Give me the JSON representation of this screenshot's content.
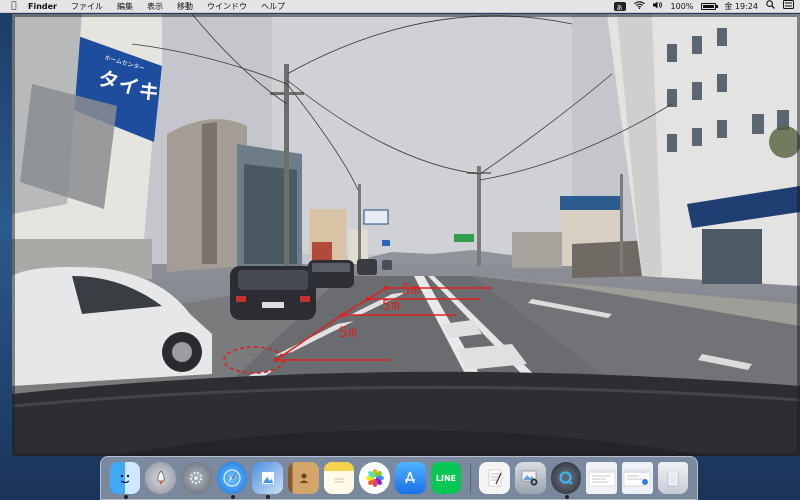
{
  "menubar": {
    "app_name": "Finder",
    "menus": [
      "ファイル",
      "編集",
      "表示",
      "移動",
      "ウインドウ",
      "ヘルプ"
    ],
    "input_source": "あ",
    "battery_percent": "100%",
    "battery_level": 1.0,
    "clock": "金 19:24"
  },
  "photo": {
    "sign_text": "タイキ",
    "sign_small": "ホームセンター",
    "annotations": [
      "5m",
      "5m",
      "5m"
    ],
    "annotation_color": "#e02020"
  },
  "dock": {
    "apps": [
      "Finder",
      "Launchpad",
      "System Preferences",
      "Safari",
      "Preview",
      "Contacts",
      "Notes",
      "Photos",
      "App Store",
      "LINE"
    ],
    "line_label": "LINE",
    "others": [
      "TextEdit",
      "Image Capture",
      "QuickTime Player",
      "Window 1",
      "Window 2",
      "Trash"
    ]
  },
  "icons": [
    "apple-icon",
    "wifi-icon",
    "volume-icon",
    "battery-icon",
    "search-icon",
    "control-center-icon"
  ]
}
